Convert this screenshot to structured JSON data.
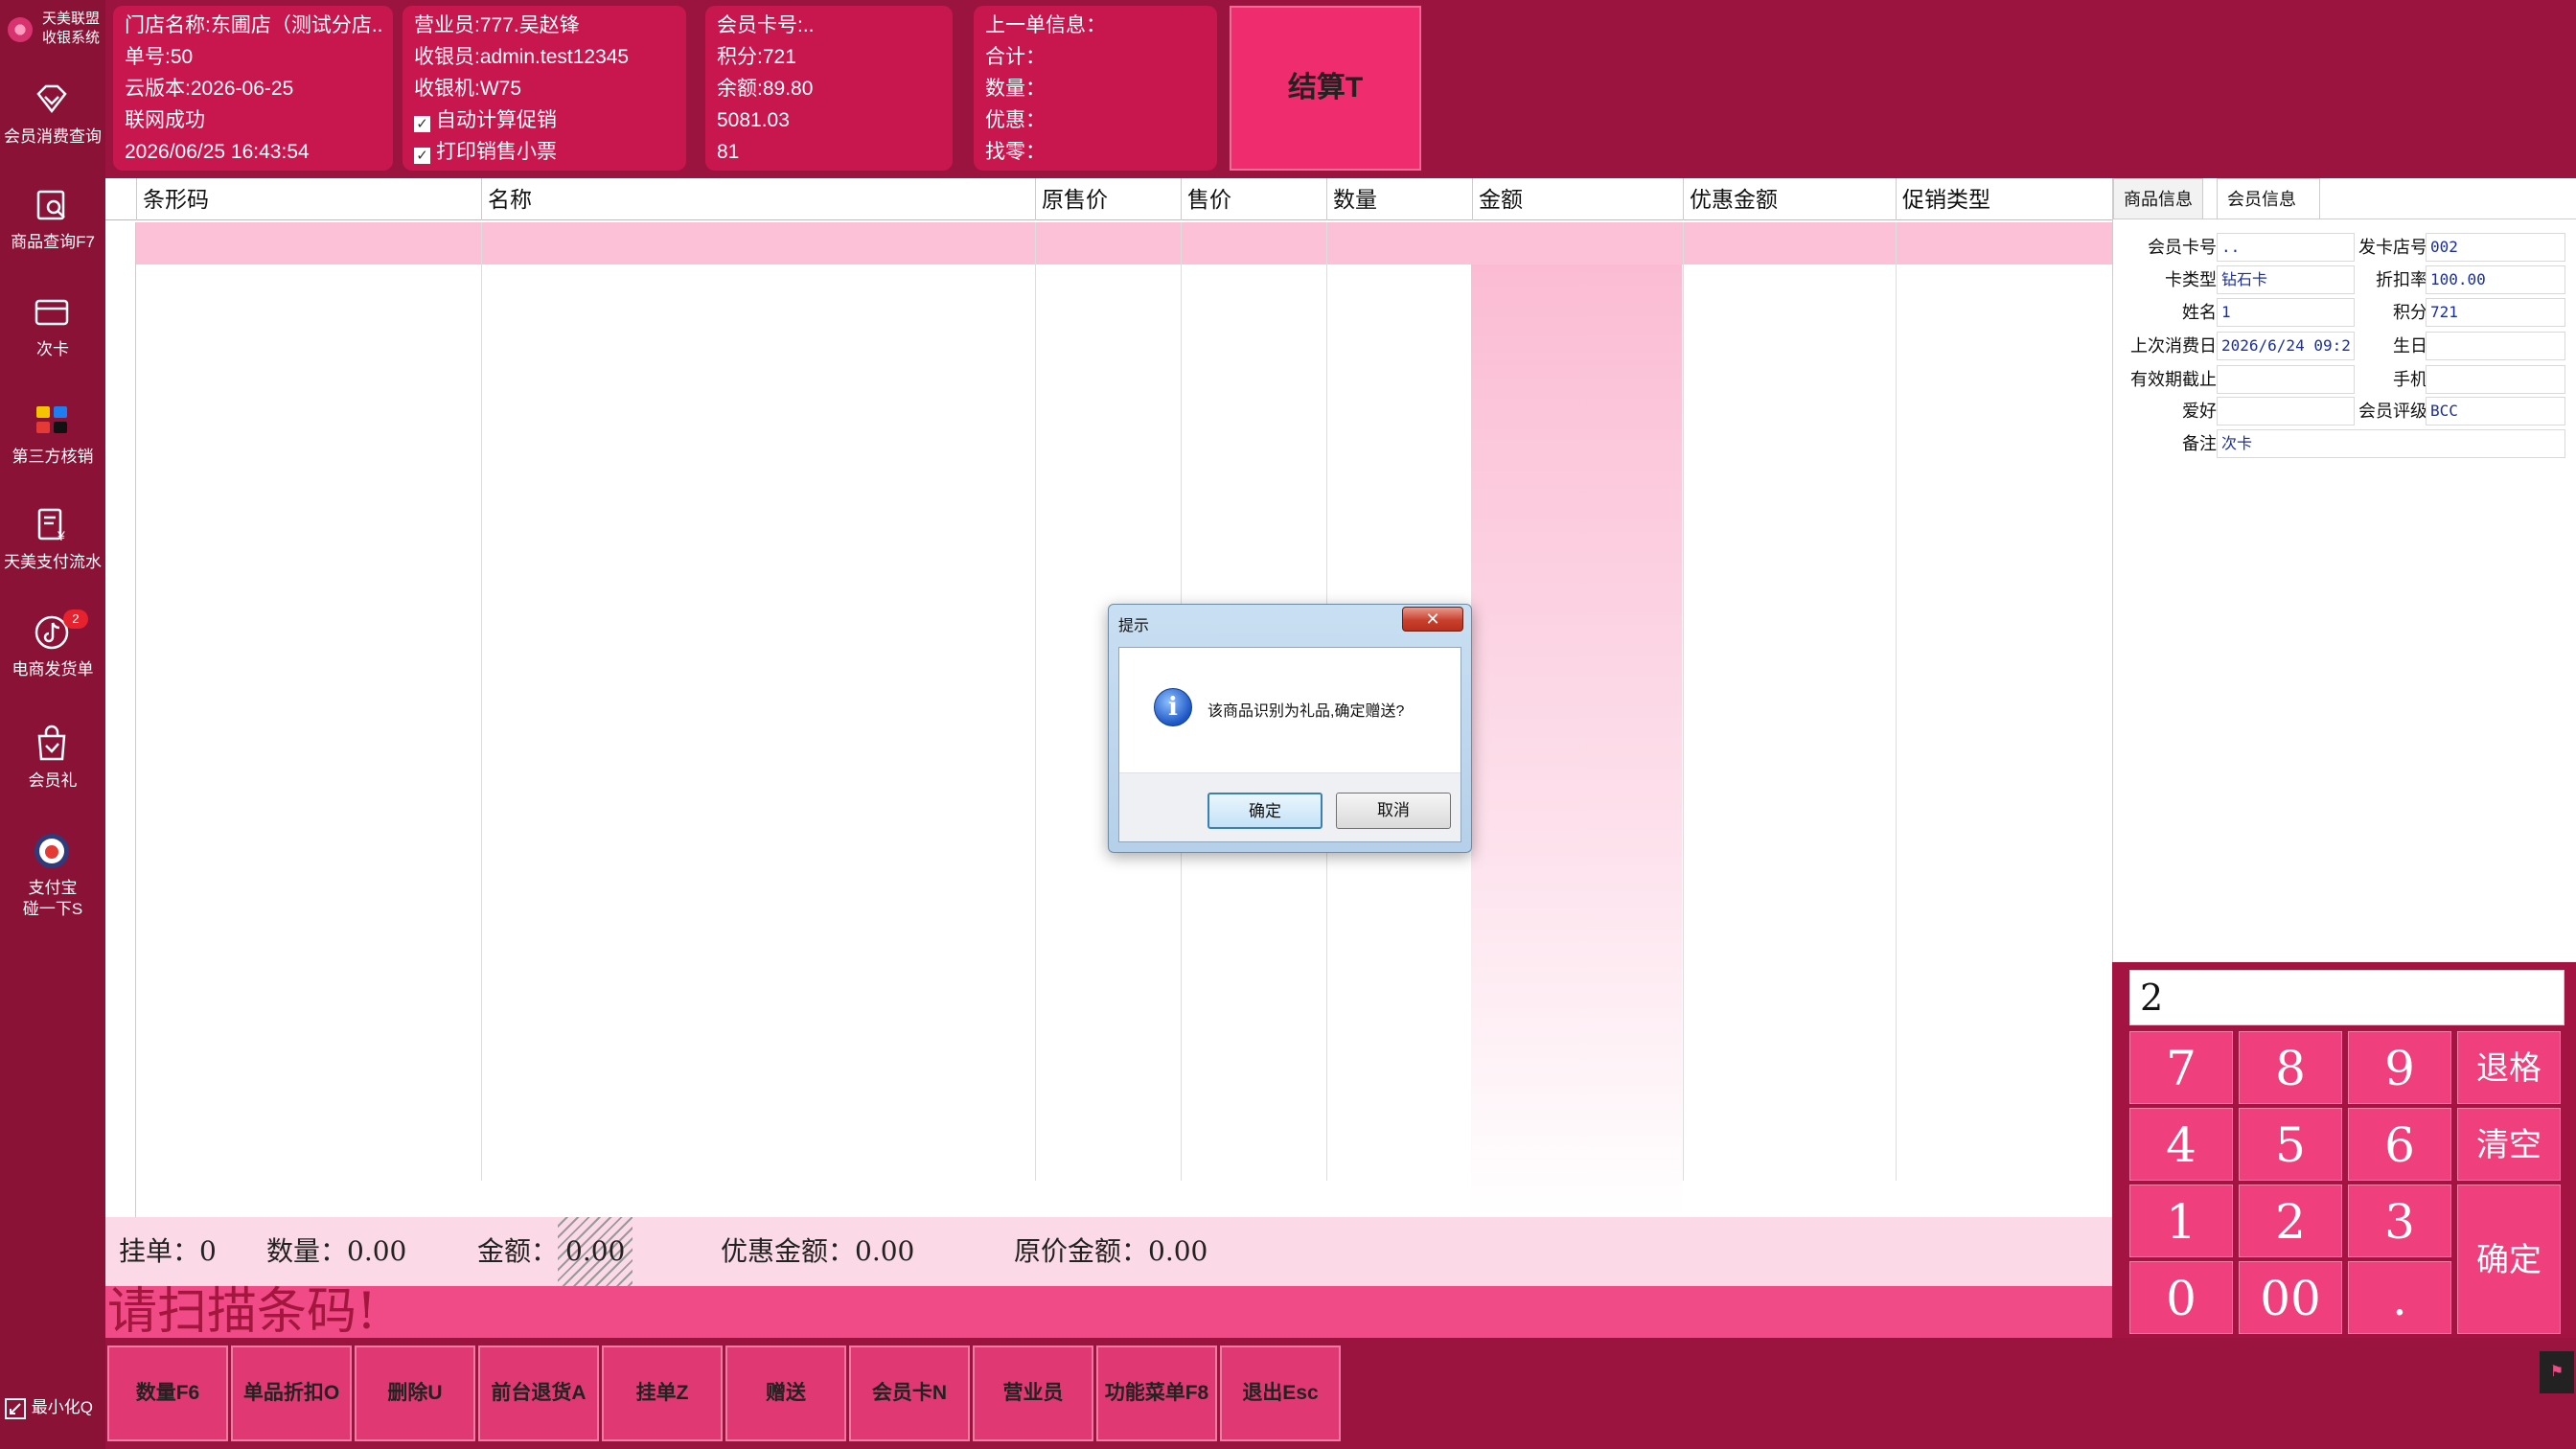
{
  "colors": {
    "brand": "#9b1440",
    "accent": "#ee2c6e",
    "row_highlight": "#fcc1d7"
  },
  "sidebar": {
    "logo_line1": "天美联盟",
    "logo_line2": "收银系统",
    "items": [
      {
        "label": "会员消费查询",
        "icon": "diamond-icon"
      },
      {
        "label": "商品查询F7",
        "icon": "product-search-icon"
      },
      {
        "label": "次卡",
        "icon": "card-icon"
      },
      {
        "label": "第三方核销",
        "icon": "third-party-apps-icon"
      },
      {
        "label": "天美支付流水",
        "icon": "payment-record-icon"
      },
      {
        "label": "电商发货单",
        "icon": "tiktok-icon",
        "badge": "2"
      },
      {
        "label": "会员礼",
        "icon": "gift-bag-icon"
      },
      {
        "label": "支付宝",
        "label2": "碰一下S",
        "icon": "alipay-tap-icon"
      }
    ],
    "shrink_label": "最小化Q"
  },
  "store": {
    "store_name": "门店名称:东圃店（测试分店...",
    "order_no": "单号:50",
    "cloud_version": "云版本:2026-06-25",
    "network": "联网成功",
    "datetime": "2026/06/25 16:43:54"
  },
  "staff": {
    "salesperson": "营业员:777.吴赵锋",
    "cashier": "收银员:admin.test12345",
    "register": "收银机:W75",
    "auto_promo": "自动计算促销",
    "print_receipt": "打印销售小票"
  },
  "member_summary": {
    "card_no": "会员卡号:..",
    "points": "积分:721",
    "balance": "余额:89.80",
    "value1": "5081.03",
    "value2": "81"
  },
  "last_order": {
    "title": "上一单信息：",
    "total": "合计：",
    "quantity": "数量：",
    "discount": "优惠：",
    "change": "找零："
  },
  "settle_label": "结算T",
  "table": {
    "columns": [
      "条形码",
      "名称",
      "原售价",
      "售价",
      "数量",
      "金额",
      "优惠金额",
      "促销类型"
    ]
  },
  "summary": {
    "hold": "挂单：0",
    "quantity": "数量：0.00",
    "amount_label": "金额：",
    "amount": "0.00",
    "discount": "优惠金额：0.00",
    "original": "原价金额：0.00"
  },
  "scan_hint": "请扫描条码!",
  "toolbar": [
    "数量F6",
    "单品折扣O",
    "删除U",
    "前台退货A",
    "挂单Z",
    "赠送",
    "会员卡N",
    "营业员",
    "功能菜单F8",
    "退出Esc"
  ],
  "right_tabs": {
    "product": "商品信息",
    "member": "会员信息"
  },
  "member_info": {
    "card_no_label": "会员卡号",
    "card_no": "..",
    "issue_store_label": "发卡店号",
    "issue_store": "002",
    "card_type_label": "卡类型",
    "card_type": "钻石卡",
    "discount_label": "折扣率",
    "discount": "100.00",
    "name_label": "姓名",
    "name": "1",
    "points_label": "积分",
    "points": "721",
    "last_visit_label": "上次消费日",
    "last_visit": "2026/6/24 09:2",
    "birthday_label": "生日",
    "birthday": "",
    "expiry_label": "有效期截止",
    "expiry": "",
    "phone_label": "手机",
    "phone": "",
    "hobby_label": "爱好",
    "hobby": "",
    "level_label": "会员评级",
    "level": "BCC",
    "note_label": "备注",
    "note": "次卡"
  },
  "keypad": {
    "display": "2",
    "keys": [
      "7",
      "8",
      "9",
      "4",
      "5",
      "6",
      "1",
      "2",
      "3",
      "0",
      "00",
      "."
    ],
    "backspace": "退格",
    "clear": "清空",
    "confirm": "确定"
  },
  "dialog": {
    "title": "提示",
    "message": "该商品识别为礼品,确定赠送?",
    "ok": "确定",
    "cancel": "取消"
  }
}
